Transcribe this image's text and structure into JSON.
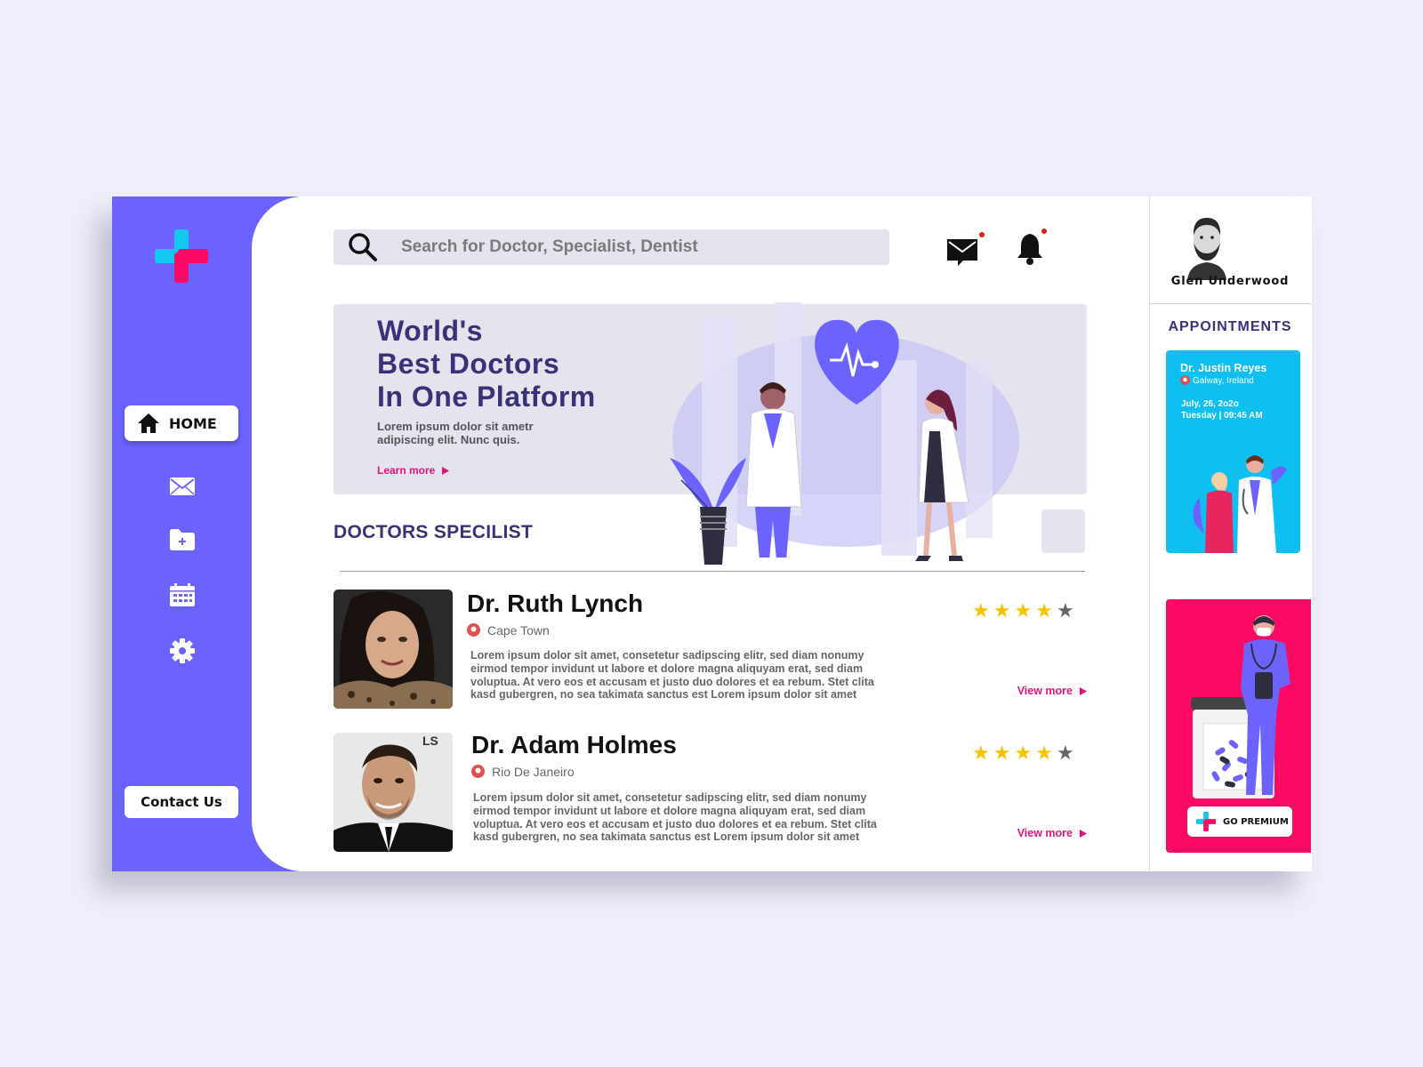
{
  "search": {
    "placeholder": "Search for Doctor, Specialist, Dentist"
  },
  "sidebar": {
    "items": [
      {
        "label": "HOME",
        "icon": "home-icon",
        "active": true
      },
      {
        "icon": "mail-icon"
      },
      {
        "icon": "add-folder-icon"
      },
      {
        "icon": "calendar-icon"
      },
      {
        "icon": "gear-icon"
      }
    ],
    "contact_label": "Contact Us"
  },
  "header": {
    "mail_unread": true,
    "bell_unread": true
  },
  "banner": {
    "title_lines": [
      "World's",
      "Best Doctors",
      "In One Platform"
    ],
    "subtitle": "Lorem ipsum dolor sit ametr adipiscing elit. Nunc quis.",
    "cta": "Learn more"
  },
  "doctors": {
    "title": "DOCTORS SPECILIST",
    "list": [
      {
        "name": "Dr. Ruth Lynch",
        "location": "Cape Town",
        "description": "Lorem ipsum dolor sit amet, consetetur sadipscing elitr, sed diam nonumy eirmod tempor invidunt ut labore et dolore magna aliquyam erat, sed diam voluptua. At vero eos et accusam et justo duo dolores et ea rebum. Stet clita kasd gubergren, no sea takimata sanctus est Lorem ipsum dolor sit amet",
        "rating": 4,
        "rating_max": 5,
        "cta": "View more"
      },
      {
        "name": "Dr. Adam Holmes",
        "location": "Rio De Janeiro",
        "description": "Lorem ipsum dolor sit amet, consetetur sadipscing elitr, sed diam nonumy eirmod tempor invidunt ut labore et dolore magna aliquyam erat, sed diam voluptua. At vero eos et accusam et justo duo dolores et ea rebum. Stet clita kasd gubergren, no sea takimata sanctus est Lorem ipsum dolor sit amet",
        "rating": 4,
        "rating_max": 5,
        "cta": "View more"
      }
    ]
  },
  "user": {
    "name": "Glen Underwood"
  },
  "appointments": {
    "title": "APPOINTMENTS",
    "card": {
      "doctor": "Dr. Justin Reyes",
      "location": "Galway, Ireland",
      "date": "July, 26, 2o2o",
      "time": "Tuesday | 09:45 AM"
    }
  },
  "premium": {
    "label": "GO PREMIUM"
  },
  "colors": {
    "brand": "#6c63ff",
    "navy": "#3a3278",
    "accent_pink": "#e0157a",
    "premium_bg": "#fa0a65",
    "appointment_bg": "#0fbff0",
    "star_on": "#f5c400",
    "star_off": "#666666"
  }
}
